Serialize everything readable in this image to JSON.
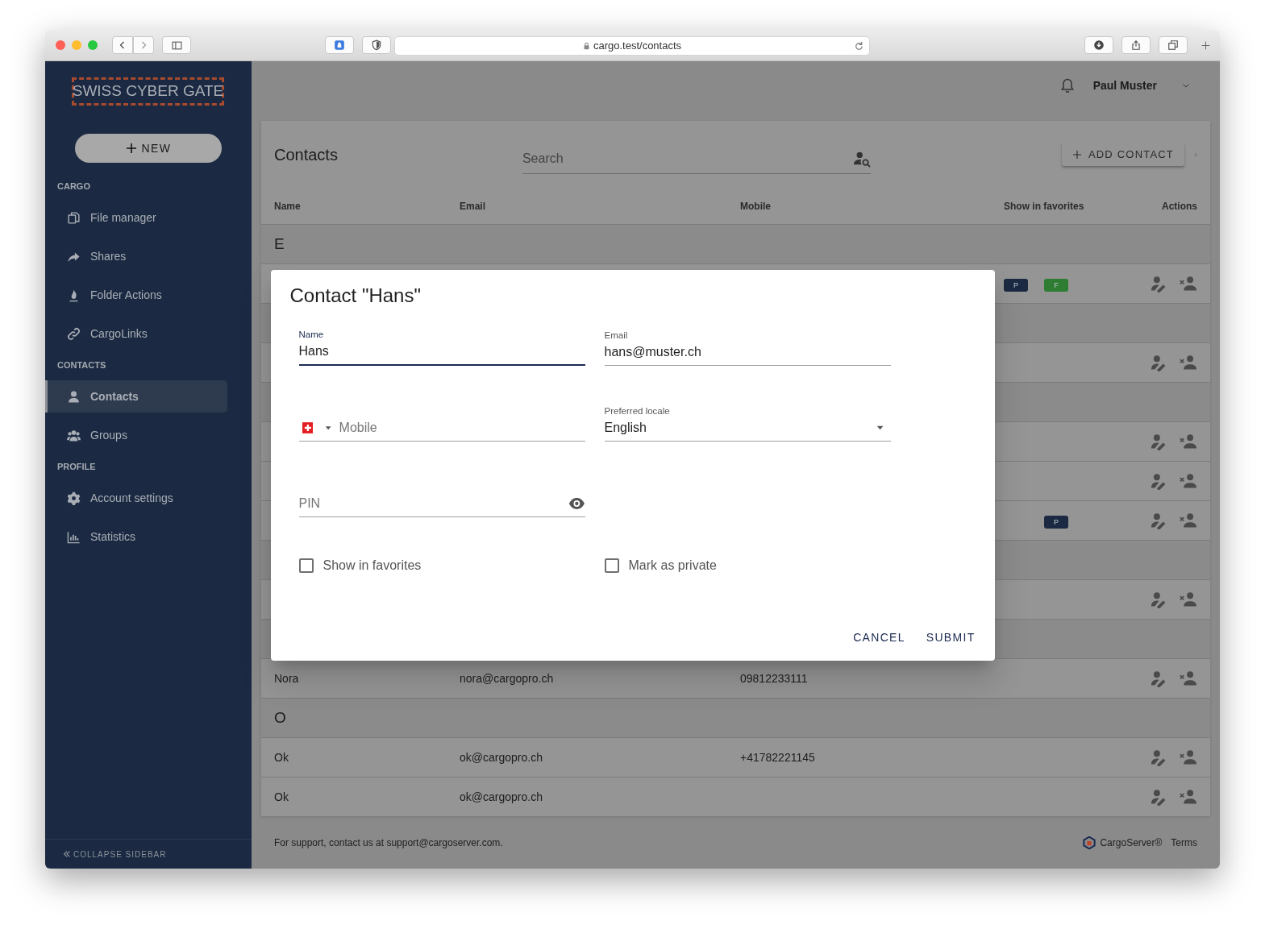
{
  "browser": {
    "url": "cargo.test/contacts"
  },
  "sidebar": {
    "logo": "SWISS CYBER GATE",
    "new_button": "NEW",
    "sections": [
      {
        "title": "CARGO",
        "items": [
          {
            "label": "File manager",
            "selected": false
          },
          {
            "label": "Shares",
            "selected": false
          },
          {
            "label": "Folder Actions",
            "selected": false
          },
          {
            "label": "CargoLinks",
            "selected": false
          }
        ]
      },
      {
        "title": "CONTACTS",
        "items": [
          {
            "label": "Contacts",
            "selected": true
          },
          {
            "label": "Groups",
            "selected": false
          }
        ]
      },
      {
        "title": "PROFILE",
        "items": [
          {
            "label": "Account settings",
            "selected": false
          },
          {
            "label": "Statistics",
            "selected": false
          }
        ]
      }
    ],
    "collapse": "COLLAPSE SIDEBAR"
  },
  "topbar": {
    "user": "Paul Muster"
  },
  "contacts": {
    "title": "Contacts",
    "search": {
      "placeholder": "Search"
    },
    "add_button": "ADD CONTACT",
    "columns": [
      "Name",
      "Email",
      "Mobile",
      "Show in favorites",
      "Actions"
    ],
    "rows": [
      {
        "kind": "group",
        "letter": "E"
      },
      {
        "kind": "contact",
        "badge_left": {
          "text": "P",
          "color": "#1b2a42"
        },
        "badge_right": {
          "text": "F",
          "color": "#2e7d32"
        }
      },
      {
        "kind": "group"
      },
      {
        "kind": "contact"
      },
      {
        "kind": "group"
      },
      {
        "kind": "contact"
      },
      {
        "kind": "contact"
      },
      {
        "kind": "contact",
        "badge_right": {
          "text": "P",
          "color": "#1b2a42"
        }
      },
      {
        "kind": "group"
      },
      {
        "kind": "contact"
      },
      {
        "kind": "group"
      },
      {
        "kind": "contact",
        "name": "Nora",
        "email": "nora@cargopro.ch",
        "mobile": "09812233111"
      },
      {
        "kind": "group",
        "letter": "O"
      },
      {
        "kind": "contact",
        "name": "Ok",
        "email": "ok@cargopro.ch",
        "mobile": "+41782221145"
      },
      {
        "kind": "contact",
        "name": "Ok",
        "email": "ok@cargopro.ch"
      }
    ]
  },
  "footer": {
    "text": "For support, contact us at support@cargoserver.com.",
    "brand": "CargoServer®",
    "terms": "Terms"
  },
  "dialog": {
    "title": "Contact \"Hans\"",
    "fields": [
      {
        "kind": "text",
        "label": "Name",
        "value": "Hans",
        "focused": true
      },
      {
        "kind": "text",
        "label": "Email",
        "value": "hans@muster.ch",
        "focused": false
      },
      {
        "kind": "phone",
        "placeholder": "Mobile",
        "focused": false
      },
      {
        "kind": "select",
        "label": "Preferred locale",
        "value": "English",
        "focused": false
      },
      {
        "kind": "password",
        "placeholder": "PIN",
        "focused": false
      }
    ],
    "checkboxes": [
      {
        "label": "Show in favorites",
        "checked": false
      },
      {
        "label": "Mark as private",
        "checked": false
      }
    ],
    "buttons": [
      "CANCEL",
      "SUBMIT"
    ]
  }
}
